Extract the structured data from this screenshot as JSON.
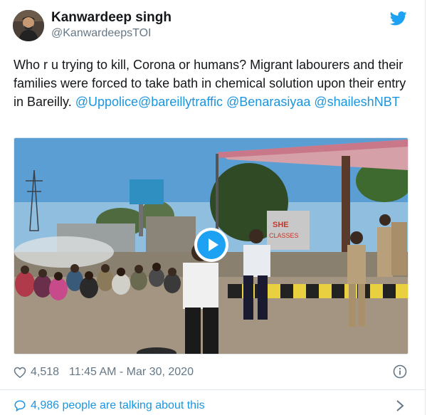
{
  "user": {
    "display_name": "Kanwardeep singh",
    "handle": "@KanwardeepsTOI"
  },
  "tweet": {
    "text": "Who r u trying to kill, Corona or humans? Migrant labourers and their families were forced to take bath in chemical solution upon their entry in Bareilly. ",
    "mentions": [
      "@Uppolice",
      "@bareillytraffic",
      "@Benarasiyaa",
      "@shaileshNBT"
    ]
  },
  "media": {
    "type": "video",
    "sign_text": "SHE\nCLASSES"
  },
  "meta": {
    "likes": "4,518",
    "timestamp": "11:45 AM - Mar 30, 2020"
  },
  "footer": {
    "talking_text": "4,986 people are talking about this"
  },
  "colors": {
    "brand_blue": "#1da1f2",
    "link_blue": "#1b95e0",
    "secondary_text": "#657786"
  }
}
